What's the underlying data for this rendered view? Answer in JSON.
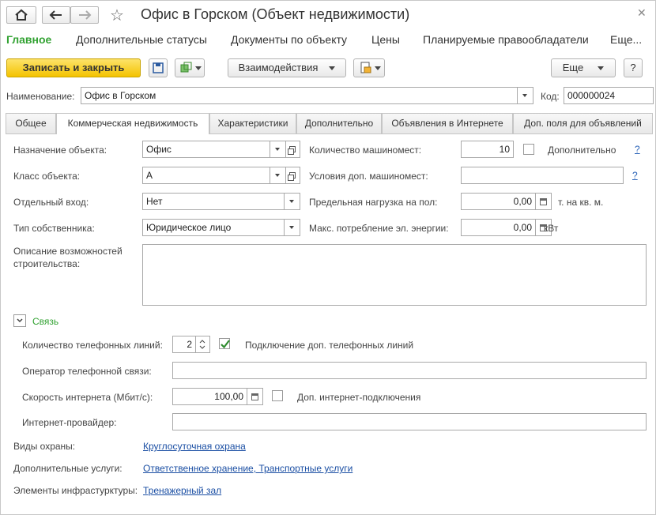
{
  "window": {
    "title": "Офис в Горском (Объект недвижимости)"
  },
  "nav": {
    "items": [
      {
        "label": "Главное"
      },
      {
        "label": "Дополнительные статусы"
      },
      {
        "label": "Документы по объекту"
      },
      {
        "label": "Цены"
      },
      {
        "label": "Планируемые правообладатели"
      },
      {
        "label": "Еще..."
      }
    ]
  },
  "toolbar": {
    "save_close": "Записать и закрыть",
    "interactions": "Взаимодействия",
    "more": "Еще",
    "help": "?"
  },
  "header": {
    "name_label": "Наименование:",
    "name_value": "Офис в Горском",
    "code_label": "Код:",
    "code_value": "000000024"
  },
  "tabs": [
    {
      "label": "Общее"
    },
    {
      "label": "Коммерческая недвижимость"
    },
    {
      "label": "Характеристики"
    },
    {
      "label": "Дополнительно"
    },
    {
      "label": "Объявления в Интернете"
    },
    {
      "label": "Доп. поля для объявлений"
    }
  ],
  "form": {
    "purpose_label": "Назначение объекта:",
    "purpose_value": "Офис",
    "class_label": "Класс объекта:",
    "class_value": "А",
    "entrance_label": "Отдельный вход:",
    "entrance_value": "Нет",
    "owner_label": "Тип собственника:",
    "owner_value": "Юридическое лицо",
    "parking_label": "Количество машиномест:",
    "parking_value": "10",
    "parking_extra_label": "Дополнительно",
    "parking_extra_checked": false,
    "parking_cond_label": "Условия доп. машиномест:",
    "parking_cond_value": "",
    "load_label": "Предельная нагрузка на пол:",
    "load_value": "0,00",
    "load_unit": "т. на кв. м.",
    "power_label": "Макс. потребление эл. энергии:",
    "power_value": "0,00",
    "power_unit": "кВт",
    "desc_label": "Описание возможностей строительства:",
    "desc_value": "",
    "help_mark": "?"
  },
  "connection": {
    "group_title": "Связь",
    "lines_label": "Количество телефонных линий:",
    "lines_value": "2",
    "extra_lines_label": "Подключение доп. телефонных линий",
    "extra_lines_checked": true,
    "operator_label": "Оператор телефонной связи:",
    "operator_value": "",
    "speed_label": "Скорость интернета (Мбит/с):",
    "speed_value": "100,00",
    "extra_internet_label": "Доп. интернет-подключения",
    "extra_internet_checked": false,
    "provider_label": "Интернет-провайдер:",
    "provider_value": ""
  },
  "extras": {
    "security_label": "Виды охраны:",
    "security_value": "Круглосуточная охрана",
    "services_label": "Дополнительные услуги:",
    "services_value": "Ответственное хранение, Транспортные услуги",
    "infra_label": "Элементы инфрастурктуры:",
    "infra_value": "Тренажерный зал"
  },
  "colors": {
    "accent": "#32a232",
    "primary_button": "#f4c300",
    "link": "#1a4ea3"
  }
}
